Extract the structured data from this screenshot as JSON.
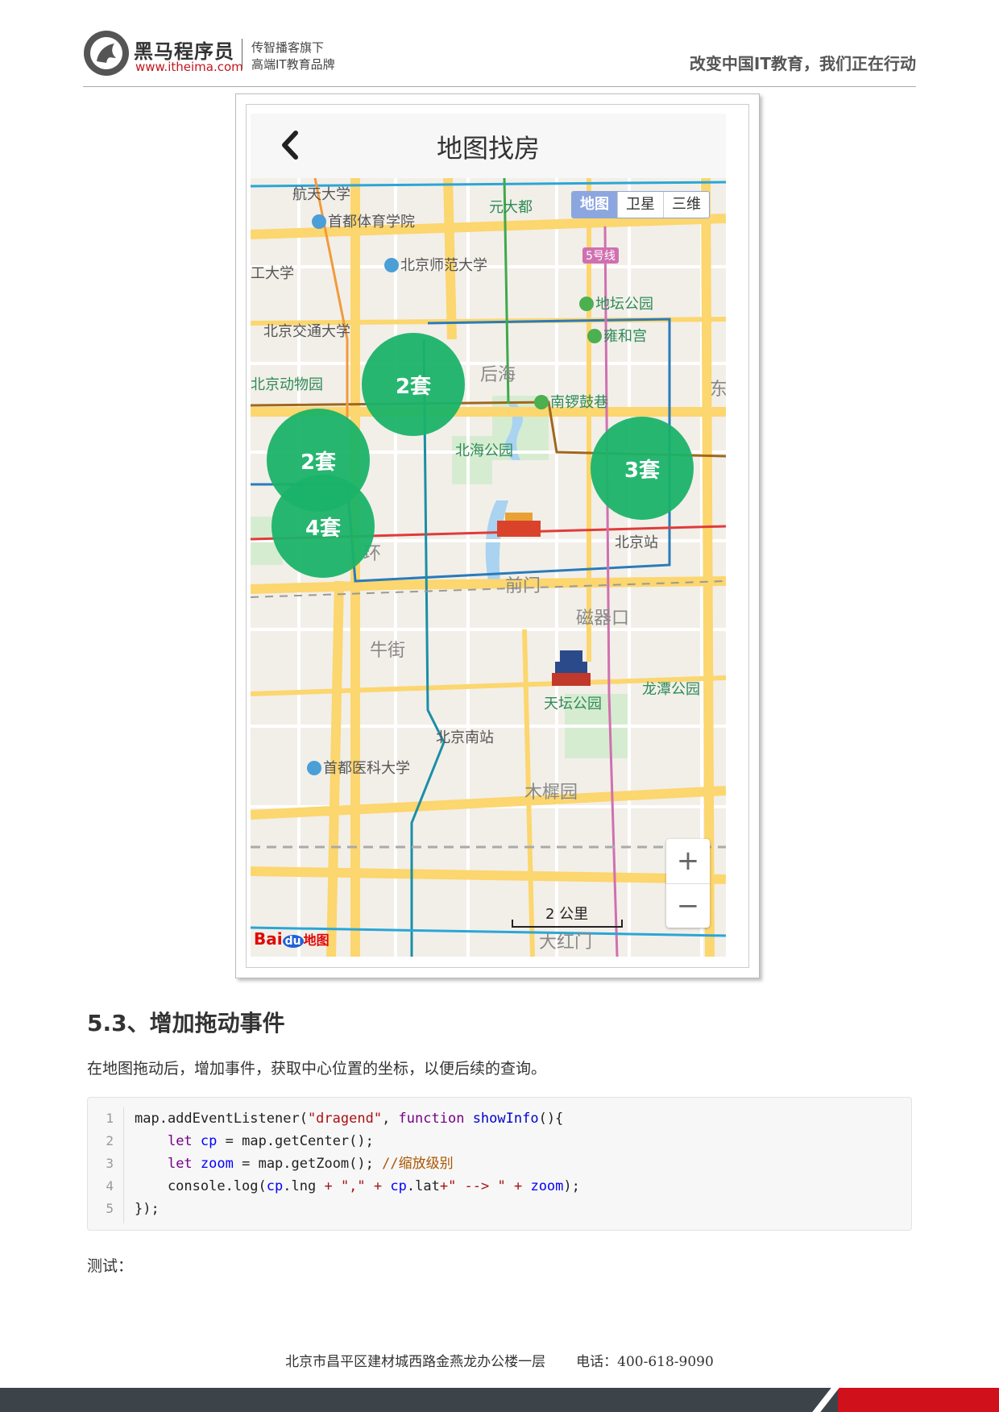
{
  "header": {
    "brand_name": "黑马程序员",
    "brand_url": "www.itheima.com",
    "tagline_line1": "传智播客旗下",
    "tagline_line2": "高端IT教育品牌",
    "slogan": "改变中国IT教育，我们正在行动"
  },
  "screenshot": {
    "title": "地图找房",
    "map_type_options": [
      "地图",
      "卫星",
      "三维"
    ],
    "active_map_type": "地图",
    "clusters": [
      {
        "label": "2套"
      },
      {
        "label": "2套"
      },
      {
        "label": "4套"
      },
      {
        "label": "3套"
      }
    ],
    "map_labels": {
      "l1": "航天大学",
      "l2": "首都体育学院",
      "l3": "元大都",
      "l4": "北京师范大学",
      "l5": "5号线",
      "l6": "工大学",
      "l7": "地坛公园",
      "l8": "北京交通大学",
      "l9": "雍和宫",
      "l10": "北京动物园",
      "l11": "后海",
      "l12": "南锣鼓巷",
      "l13": "北海公园",
      "l14": "北京站",
      "l15": "前门",
      "l16": "磁器口",
      "l17": "牛街",
      "l18": "龙潭公园",
      "l19": "天坛公园",
      "l20": "北京南站",
      "l21": "首都医科大学",
      "l22": "木樨园",
      "l23": "大红门",
      "l24": "东",
      "l25": "环"
    },
    "zoom_in": "+",
    "zoom_out": "−",
    "scale_label": "2 公里",
    "map_logo": "Bai",
    "map_logo_badge": "du",
    "map_logo_suffix": "地图"
  },
  "section": {
    "title": "5.3、增加拖动事件",
    "paragraph": "在地图拖动后，增加事件，获取中心位置的坐标，以便后续的查询。",
    "code_lines": [
      "1",
      "2",
      "3",
      "4",
      "5"
    ],
    "code": {
      "l1_a": "map.addEventListener(",
      "l1_b": "\"dragend\"",
      "l1_c": ", ",
      "l1_d": "function",
      "l1_e": " ",
      "l1_f": "showInfo",
      "l1_g": "(){",
      "l2_a": "    ",
      "l2_b": "let",
      "l2_c": " ",
      "l2_d": "cp",
      "l2_e": " = map.getCenter();",
      "l3_a": "    ",
      "l3_b": "let",
      "l3_c": " ",
      "l3_d": "zoom",
      "l3_e": " = map.getZoom(); ",
      "l3_f": "//缩放级别",
      "l4_a": "    console.log(",
      "l4_b": "cp",
      "l4_c": ".lng ",
      "l4_d": "+",
      "l4_e": " ",
      "l4_f": "\",\"",
      "l4_g": " ",
      "l4_h": "+",
      "l4_i": " ",
      "l4_j": "cp",
      "l4_k": ".lat",
      "l4_l": "+\" --> \" +",
      "l4_m": " ",
      "l4_n": "zoom",
      "l4_o": ");",
      "l5_a": "});"
    },
    "test_label": "测试："
  },
  "footer": {
    "address": "北京市昌平区建材城西路金燕龙办公楼一层",
    "phone": "电话：400-618-9090"
  },
  "colors": {
    "cluster": "#1ab368",
    "brand_red": "#c4161c",
    "footer_dark": "#3c4449",
    "footer_red": "#d0111b"
  }
}
